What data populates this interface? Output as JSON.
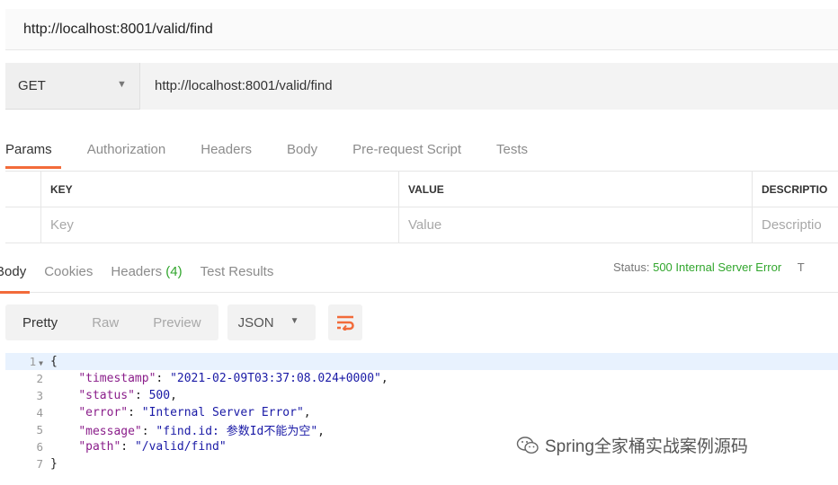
{
  "window": {
    "title": "http://localhost:8001/valid/find"
  },
  "request": {
    "method": "GET",
    "url": "http://localhost:8001/valid/find"
  },
  "request_tabs": [
    "Params",
    "Authorization",
    "Headers",
    "Body",
    "Pre-request Script",
    "Tests"
  ],
  "params": {
    "headers": {
      "key": "KEY",
      "value": "VALUE",
      "description": "DESCRIPTIO"
    },
    "placeholders": {
      "key": "Key",
      "value": "Value",
      "description": "Descriptio"
    }
  },
  "response_tabs": {
    "body": "Body",
    "cookies": "Cookies",
    "headers": "Headers",
    "headers_count": "(4)",
    "test_results": "Test Results"
  },
  "status": {
    "label": "Status:",
    "value": "500 Internal Server Error",
    "trailing": "T"
  },
  "view_modes": [
    "Pretty",
    "Raw",
    "Preview"
  ],
  "format": "JSON",
  "code": {
    "line_numbers": [
      "1",
      "2",
      "3",
      "4",
      "5",
      "6",
      "7"
    ],
    "open_brace": "{",
    "close_brace": "}",
    "fields": [
      {
        "key": "\"timestamp\"",
        "value": "\"2021-02-09T03:37:08.024+0000\"",
        "trail": ","
      },
      {
        "key": "\"status\"",
        "value": "500",
        "trail": ","
      },
      {
        "key": "\"error\"",
        "value": "\"Internal Server Error\"",
        "trail": ","
      },
      {
        "key": "\"message\"",
        "value": "\"find.id: 参数Id不能为空\"",
        "trail": ","
      },
      {
        "key": "\"path\"",
        "value": "\"/valid/find\"",
        "trail": ""
      }
    ]
  },
  "watermark": "Spring全家桶实战案例源码",
  "colors": {
    "accent": "#f26b3a",
    "status_ok": "#31a62d",
    "json_key": "#8a1d8a",
    "json_value": "#1a1aa6"
  },
  "icons": [
    "caret-down-icon",
    "wrap-lines-icon",
    "wechat-icon"
  ]
}
